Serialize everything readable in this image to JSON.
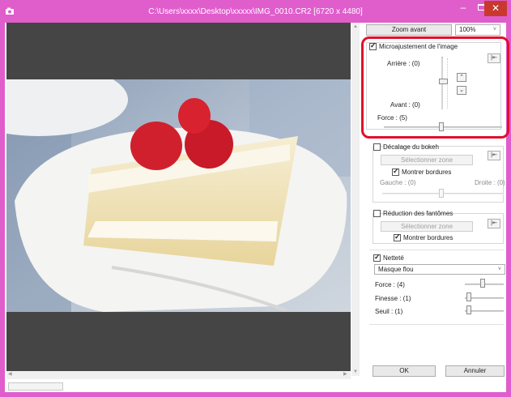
{
  "window": {
    "title": "C:\\Users\\xxxx\\Desktop\\xxxxx\\IMG_0010.CR2 [6720 x 4480]",
    "minimize": "–",
    "close": "✕"
  },
  "toolbar": {
    "zoom_button": "Zoom avant",
    "zoom_value": "100%"
  },
  "micro": {
    "label": "Microajustement de l'image",
    "checked": true,
    "back_label": "Arrière : (0)",
    "front_label": "Avant : (0)",
    "force_label": "Force : (5)",
    "force_value": 5
  },
  "bokeh": {
    "label": "Décalage du bokeh",
    "select_zone": "Sélectionner zone",
    "show_borders": "Montrer bordures",
    "left_label": "Gauche : (0)",
    "right_label": "Droite : (0)"
  },
  "ghost": {
    "label": "Réduction des fantômes",
    "select_zone": "Sélectionner zone",
    "show_borders": "Montrer bordures"
  },
  "sharpness": {
    "label": "Netteté",
    "mode": "Masque flou",
    "force_label": "Force : (4)",
    "fineness_label": "Finesse : (1)",
    "threshold_label": "Seuil : (1)",
    "force_value": 4,
    "fineness_value": 1,
    "threshold_value": 1
  },
  "footer": {
    "ok": "OK",
    "cancel": "Annuler"
  },
  "colors": {
    "title_bar": "#e05dcc",
    "highlight": "#e0102a",
    "preview_bg": "#454545"
  },
  "icons": {
    "app": "camera-app-icon",
    "reset": "reset-arrow-icon",
    "up": "chevron-up-icon",
    "down": "chevron-down-icon"
  }
}
